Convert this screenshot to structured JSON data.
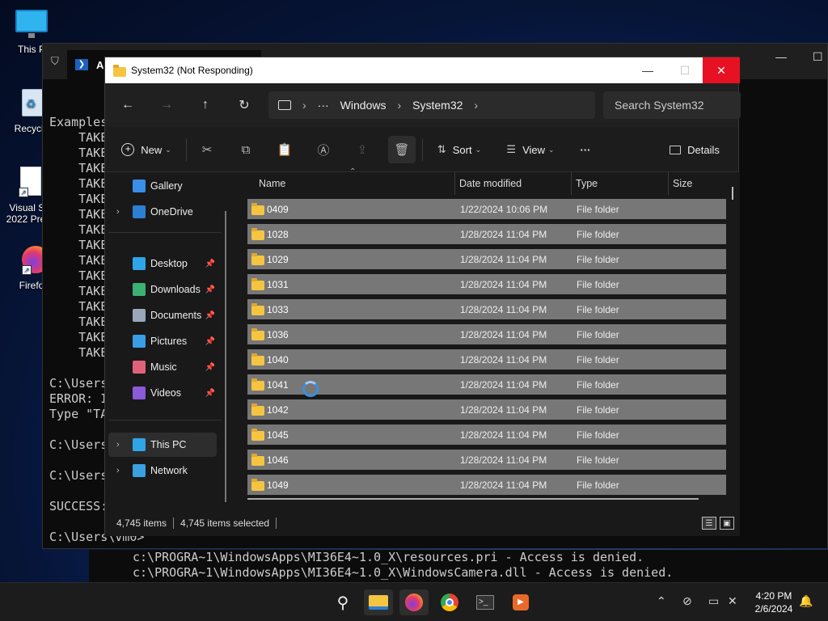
{
  "desktop": {
    "icons": [
      {
        "label_line1": "This P",
        "label_line2": ""
      },
      {
        "label_line1": "Recycle",
        "label_line2": ""
      },
      {
        "label_line1": "Visual St",
        "label_line2": "2022 Prev"
      },
      {
        "label_line1": "Firefo",
        "label_line2": ""
      }
    ]
  },
  "terminal": {
    "tab_title": "Ac",
    "lines": [
      "Examples",
      "    TAKE",
      "    TAKE",
      "    TAKE",
      "    TAKE",
      "    TAKE",
      "    TAKE",
      "    TAKE",
      "    TAKE",
      "    TAKE",
      "    TAKE",
      "    TAKE",
      "    TAKE",
      "    TAKE",
      "    TAKE",
      "    TAKE",
      "",
      "C:\\Users",
      "ERROR: I",
      "Type \"TA",
      "",
      "C:\\Users",
      "",
      "C:\\Users",
      "",
      "SUCCESS:",
      "",
      "C:\\Users\\vm0>"
    ],
    "below_lines": [
      "c:\\PROGRA~1\\WindowsApps\\MI36E4~1.0_X\\resources.pri - Access is denied.",
      "c:\\PROGRA~1\\WindowsApps\\MI36E4~1.0_X\\WindowsCamera.dll - Access is denied."
    ]
  },
  "explorer": {
    "title": "System32 (Not Responding)",
    "breadcrumb": [
      "···",
      "Windows",
      "System32"
    ],
    "search_placeholder": "Search System32",
    "toolbar": {
      "new_label": "New",
      "sort_label": "Sort",
      "view_label": "View",
      "more_label": "···",
      "details_label": "Details"
    },
    "nav": [
      {
        "label": "Gallery",
        "icon": "gallery-icon",
        "color": "#3a8ee6"
      },
      {
        "label": "OneDrive",
        "icon": "onedrive-icon",
        "color": "#2d7fd3"
      },
      {
        "label": "Desktop",
        "icon": "desktop-icon",
        "color": "#2fa4e7"
      },
      {
        "label": "Downloads",
        "icon": "downloads-icon",
        "color": "#3bb273"
      },
      {
        "label": "Documents",
        "icon": "documents-icon",
        "color": "#9aa7b8"
      },
      {
        "label": "Pictures",
        "icon": "pictures-icon",
        "color": "#3a9ee6"
      },
      {
        "label": "Music",
        "icon": "music-icon",
        "color": "#e0627a"
      },
      {
        "label": "Videos",
        "icon": "videos-icon",
        "color": "#8a5ad8"
      },
      {
        "label": "This PC",
        "icon": "this-pc-icon",
        "color": "#2fa4e7"
      },
      {
        "label": "Network",
        "icon": "network-icon",
        "color": "#3aa0e0"
      }
    ],
    "columns": [
      "Name",
      "Date modified",
      "Type",
      "Size"
    ],
    "rows": [
      {
        "name": "0409",
        "date": "1/22/2024 10:06 PM",
        "type": "File folder"
      },
      {
        "name": "1028",
        "date": "1/28/2024 11:04 PM",
        "type": "File folder"
      },
      {
        "name": "1029",
        "date": "1/28/2024 11:04 PM",
        "type": "File folder"
      },
      {
        "name": "1031",
        "date": "1/28/2024 11:04 PM",
        "type": "File folder"
      },
      {
        "name": "1033",
        "date": "1/28/2024 11:04 PM",
        "type": "File folder"
      },
      {
        "name": "1036",
        "date": "1/28/2024 11:04 PM",
        "type": "File folder"
      },
      {
        "name": "1040",
        "date": "1/28/2024 11:04 PM",
        "type": "File folder"
      },
      {
        "name": "1041",
        "date": "1/28/2024 11:04 PM",
        "type": "File folder"
      },
      {
        "name": "1042",
        "date": "1/28/2024 11:04 PM",
        "type": "File folder"
      },
      {
        "name": "1045",
        "date": "1/28/2024 11:04 PM",
        "type": "File folder"
      },
      {
        "name": "1046",
        "date": "1/28/2024 11:04 PM",
        "type": "File folder"
      },
      {
        "name": "1049",
        "date": "1/28/2024 11:04 PM",
        "type": "File folder"
      }
    ],
    "status": {
      "items": "4,745 items",
      "selected": "4,745 items selected"
    }
  },
  "taskbar": {
    "apps": [
      "search-icon",
      "file-explorer-icon",
      "firefox-icon",
      "chrome-icon",
      "terminal-icon",
      "media-player-icon"
    ],
    "time": "4:20 PM",
    "date": "2/6/2024"
  }
}
